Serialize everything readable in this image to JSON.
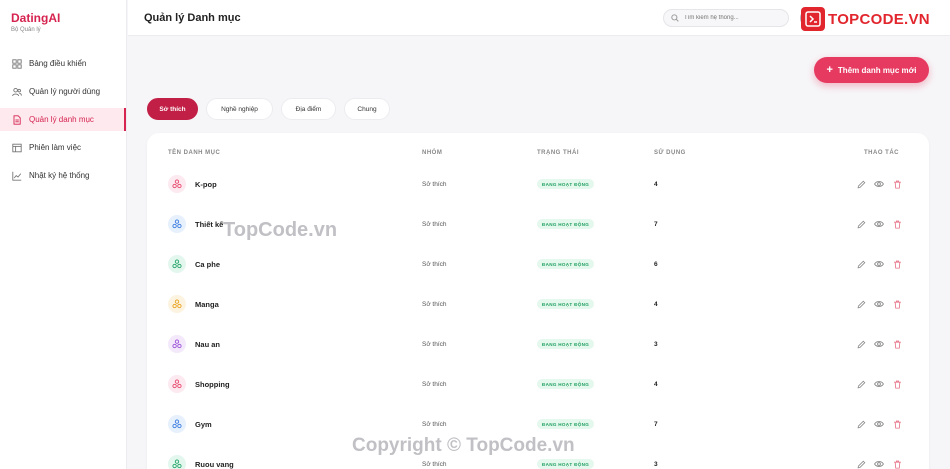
{
  "brand": {
    "title": "DatingAI",
    "subtitle": "Bộ Quản lý"
  },
  "sidebar": {
    "items": [
      {
        "label": "Bảng điều khiển",
        "icon": "grid-icon",
        "active": false
      },
      {
        "label": "Quản lý người dùng",
        "icon": "users-icon",
        "active": false
      },
      {
        "label": "Quản lý danh mục",
        "icon": "document-icon",
        "active": true
      },
      {
        "label": "Phiên làm việc",
        "icon": "window-icon",
        "active": false
      },
      {
        "label": "Nhật ký hệ thống",
        "icon": "chart-line-icon",
        "active": false
      }
    ]
  },
  "header": {
    "title": "Quản lý Danh mục",
    "search_placeholder": "Tìm kiếm hệ thống...",
    "logo_text": "TOPCODE.VN"
  },
  "toolbar": {
    "add_label": "Thêm danh mục mới"
  },
  "filters": [
    {
      "label": "Sở thích",
      "active": true
    },
    {
      "label": "Nghề nghiệp",
      "active": false
    },
    {
      "label": "Địa điểm",
      "active": false
    },
    {
      "label": "Chung",
      "active": false
    }
  ],
  "table": {
    "headers": {
      "name": "TÊN DANH MỤC",
      "group": "NHÓM",
      "status": "TRẠNG THÁI",
      "usage": "SỬ DỤNG",
      "actions": "THAO TÁC"
    },
    "rows": [
      {
        "name": "K-pop",
        "group": "Sở thích",
        "status": "ĐANG HOẠT ĐỘNG",
        "usage": "4",
        "icon_color": "#e6456b",
        "icon_bg": "#fdeaf0"
      },
      {
        "name": "Thiết kế",
        "group": "Sở thích",
        "status": "ĐANG HOẠT ĐỘNG",
        "usage": "7",
        "icon_color": "#3a7be0",
        "icon_bg": "#e7f0fd"
      },
      {
        "name": "Ca phe",
        "group": "Sở thích",
        "status": "ĐANG HOẠT ĐỘNG",
        "usage": "6",
        "icon_color": "#21a366",
        "icon_bg": "#e4f7ee"
      },
      {
        "name": "Manga",
        "group": "Sở thích",
        "status": "ĐANG HOẠT ĐỘNG",
        "usage": "4",
        "icon_color": "#e8a21c",
        "icon_bg": "#fdf3e1"
      },
      {
        "name": "Nau an",
        "group": "Sở thích",
        "status": "ĐANG HOẠT ĐỘNG",
        "usage": "3",
        "icon_color": "#9b4fd6",
        "icon_bg": "#f3e9fb"
      },
      {
        "name": "Shopping",
        "group": "Sở thích",
        "status": "ĐANG HOẠT ĐỘNG",
        "usage": "4",
        "icon_color": "#e6456b",
        "icon_bg": "#fdeaf0"
      },
      {
        "name": "Gym",
        "group": "Sở thích",
        "status": "ĐANG HOẠT ĐỘNG",
        "usage": "7",
        "icon_color": "#3a7be0",
        "icon_bg": "#e7f0fd"
      },
      {
        "name": "Ruou vang",
        "group": "Sở thích",
        "status": "ĐANG HOẠT ĐỘNG",
        "usage": "3",
        "icon_color": "#21a366",
        "icon_bg": "#e4f7ee"
      }
    ]
  },
  "watermarks": {
    "center": "TopCode.vn",
    "footer": "Copyright © TopCode.vn"
  },
  "colors": {
    "accent": "#d6234f",
    "button": "#e73a61",
    "status_bg": "#e4f8ee",
    "status_text": "#1e9f5d"
  }
}
